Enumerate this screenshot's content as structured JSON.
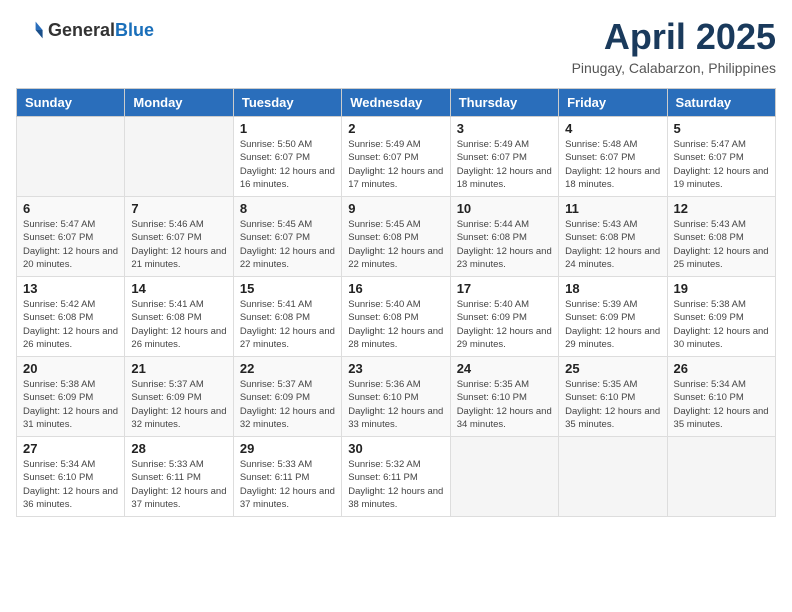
{
  "logo": {
    "text_general": "General",
    "text_blue": "Blue"
  },
  "title": "April 2025",
  "subtitle": "Pinugay, Calabarzon, Philippines",
  "weekdays": [
    "Sunday",
    "Monday",
    "Tuesday",
    "Wednesday",
    "Thursday",
    "Friday",
    "Saturday"
  ],
  "weeks": [
    [
      {
        "day": "",
        "sunrise": "",
        "sunset": "",
        "daylight": ""
      },
      {
        "day": "",
        "sunrise": "",
        "sunset": "",
        "daylight": ""
      },
      {
        "day": "1",
        "sunrise": "Sunrise: 5:50 AM",
        "sunset": "Sunset: 6:07 PM",
        "daylight": "Daylight: 12 hours and 16 minutes."
      },
      {
        "day": "2",
        "sunrise": "Sunrise: 5:49 AM",
        "sunset": "Sunset: 6:07 PM",
        "daylight": "Daylight: 12 hours and 17 minutes."
      },
      {
        "day": "3",
        "sunrise": "Sunrise: 5:49 AM",
        "sunset": "Sunset: 6:07 PM",
        "daylight": "Daylight: 12 hours and 18 minutes."
      },
      {
        "day": "4",
        "sunrise": "Sunrise: 5:48 AM",
        "sunset": "Sunset: 6:07 PM",
        "daylight": "Daylight: 12 hours and 18 minutes."
      },
      {
        "day": "5",
        "sunrise": "Sunrise: 5:47 AM",
        "sunset": "Sunset: 6:07 PM",
        "daylight": "Daylight: 12 hours and 19 minutes."
      }
    ],
    [
      {
        "day": "6",
        "sunrise": "Sunrise: 5:47 AM",
        "sunset": "Sunset: 6:07 PM",
        "daylight": "Daylight: 12 hours and 20 minutes."
      },
      {
        "day": "7",
        "sunrise": "Sunrise: 5:46 AM",
        "sunset": "Sunset: 6:07 PM",
        "daylight": "Daylight: 12 hours and 21 minutes."
      },
      {
        "day": "8",
        "sunrise": "Sunrise: 5:45 AM",
        "sunset": "Sunset: 6:07 PM",
        "daylight": "Daylight: 12 hours and 22 minutes."
      },
      {
        "day": "9",
        "sunrise": "Sunrise: 5:45 AM",
        "sunset": "Sunset: 6:08 PM",
        "daylight": "Daylight: 12 hours and 22 minutes."
      },
      {
        "day": "10",
        "sunrise": "Sunrise: 5:44 AM",
        "sunset": "Sunset: 6:08 PM",
        "daylight": "Daylight: 12 hours and 23 minutes."
      },
      {
        "day": "11",
        "sunrise": "Sunrise: 5:43 AM",
        "sunset": "Sunset: 6:08 PM",
        "daylight": "Daylight: 12 hours and 24 minutes."
      },
      {
        "day": "12",
        "sunrise": "Sunrise: 5:43 AM",
        "sunset": "Sunset: 6:08 PM",
        "daylight": "Daylight: 12 hours and 25 minutes."
      }
    ],
    [
      {
        "day": "13",
        "sunrise": "Sunrise: 5:42 AM",
        "sunset": "Sunset: 6:08 PM",
        "daylight": "Daylight: 12 hours and 26 minutes."
      },
      {
        "day": "14",
        "sunrise": "Sunrise: 5:41 AM",
        "sunset": "Sunset: 6:08 PM",
        "daylight": "Daylight: 12 hours and 26 minutes."
      },
      {
        "day": "15",
        "sunrise": "Sunrise: 5:41 AM",
        "sunset": "Sunset: 6:08 PM",
        "daylight": "Daylight: 12 hours and 27 minutes."
      },
      {
        "day": "16",
        "sunrise": "Sunrise: 5:40 AM",
        "sunset": "Sunset: 6:08 PM",
        "daylight": "Daylight: 12 hours and 28 minutes."
      },
      {
        "day": "17",
        "sunrise": "Sunrise: 5:40 AM",
        "sunset": "Sunset: 6:09 PM",
        "daylight": "Daylight: 12 hours and 29 minutes."
      },
      {
        "day": "18",
        "sunrise": "Sunrise: 5:39 AM",
        "sunset": "Sunset: 6:09 PM",
        "daylight": "Daylight: 12 hours and 29 minutes."
      },
      {
        "day": "19",
        "sunrise": "Sunrise: 5:38 AM",
        "sunset": "Sunset: 6:09 PM",
        "daylight": "Daylight: 12 hours and 30 minutes."
      }
    ],
    [
      {
        "day": "20",
        "sunrise": "Sunrise: 5:38 AM",
        "sunset": "Sunset: 6:09 PM",
        "daylight": "Daylight: 12 hours and 31 minutes."
      },
      {
        "day": "21",
        "sunrise": "Sunrise: 5:37 AM",
        "sunset": "Sunset: 6:09 PM",
        "daylight": "Daylight: 12 hours and 32 minutes."
      },
      {
        "day": "22",
        "sunrise": "Sunrise: 5:37 AM",
        "sunset": "Sunset: 6:09 PM",
        "daylight": "Daylight: 12 hours and 32 minutes."
      },
      {
        "day": "23",
        "sunrise": "Sunrise: 5:36 AM",
        "sunset": "Sunset: 6:10 PM",
        "daylight": "Daylight: 12 hours and 33 minutes."
      },
      {
        "day": "24",
        "sunrise": "Sunrise: 5:35 AM",
        "sunset": "Sunset: 6:10 PM",
        "daylight": "Daylight: 12 hours and 34 minutes."
      },
      {
        "day": "25",
        "sunrise": "Sunrise: 5:35 AM",
        "sunset": "Sunset: 6:10 PM",
        "daylight": "Daylight: 12 hours and 35 minutes."
      },
      {
        "day": "26",
        "sunrise": "Sunrise: 5:34 AM",
        "sunset": "Sunset: 6:10 PM",
        "daylight": "Daylight: 12 hours and 35 minutes."
      }
    ],
    [
      {
        "day": "27",
        "sunrise": "Sunrise: 5:34 AM",
        "sunset": "Sunset: 6:10 PM",
        "daylight": "Daylight: 12 hours and 36 minutes."
      },
      {
        "day": "28",
        "sunrise": "Sunrise: 5:33 AM",
        "sunset": "Sunset: 6:11 PM",
        "daylight": "Daylight: 12 hours and 37 minutes."
      },
      {
        "day": "29",
        "sunrise": "Sunrise: 5:33 AM",
        "sunset": "Sunset: 6:11 PM",
        "daylight": "Daylight: 12 hours and 37 minutes."
      },
      {
        "day": "30",
        "sunrise": "Sunrise: 5:32 AM",
        "sunset": "Sunset: 6:11 PM",
        "daylight": "Daylight: 12 hours and 38 minutes."
      },
      {
        "day": "",
        "sunrise": "",
        "sunset": "",
        "daylight": ""
      },
      {
        "day": "",
        "sunrise": "",
        "sunset": "",
        "daylight": ""
      },
      {
        "day": "",
        "sunrise": "",
        "sunset": "",
        "daylight": ""
      }
    ]
  ]
}
